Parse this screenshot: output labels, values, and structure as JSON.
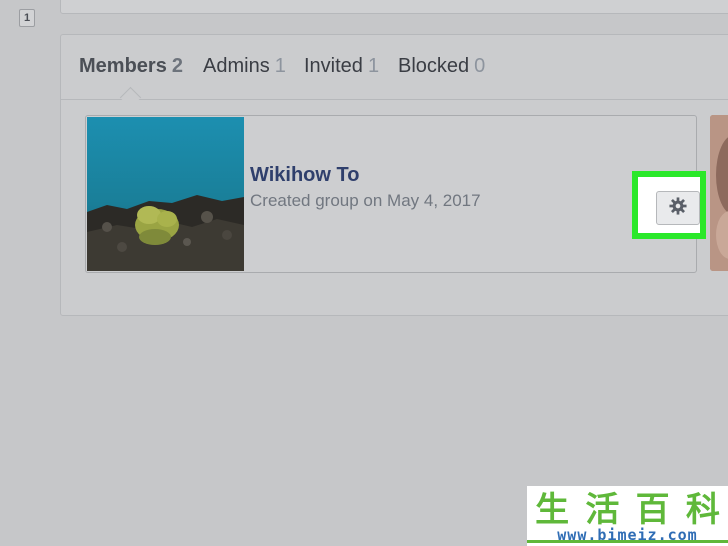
{
  "pagination": {
    "page_label": "1"
  },
  "tabs": [
    {
      "label": "Members",
      "count": "2",
      "active": true
    },
    {
      "label": "Admins",
      "count": "1",
      "active": false
    },
    {
      "label": "Invited",
      "count": "1",
      "active": false
    },
    {
      "label": "Blocked",
      "count": "0",
      "active": false
    }
  ],
  "member": {
    "name": "Wikihow To",
    "subtitle": "Created group on May 4, 2017"
  },
  "gear_button": {
    "icon": "gear-icon"
  },
  "watermark": {
    "chars": [
      "生",
      "活",
      "百",
      "科"
    ],
    "url": "www.bimeiz.com"
  },
  "colors": {
    "highlight": "#2ae82a",
    "link": "#2f3f6c",
    "watermark_green": "#5fb83a",
    "watermark_blue": "#2f6db5"
  }
}
